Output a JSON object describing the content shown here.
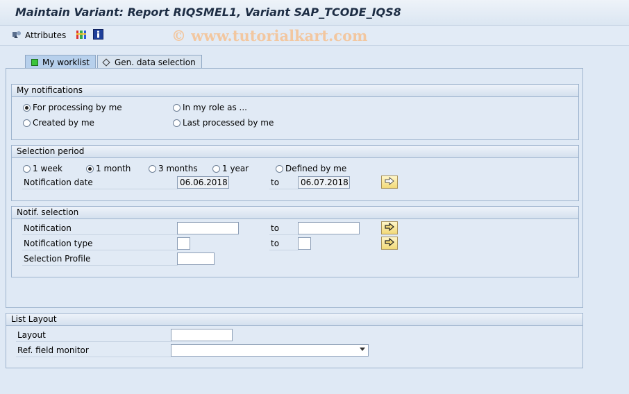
{
  "window": {
    "title": "Maintain Variant: Report RIQSMEL1, Variant SAP_TCODE_IQS8"
  },
  "toolbar": {
    "attributes_label": "Attributes",
    "watermark": "© www.tutorialkart.com"
  },
  "tabs": [
    {
      "label": "My worklist",
      "active": true
    },
    {
      "label": "Gen. data selection",
      "active": false
    }
  ],
  "my_notifications": {
    "title": "My notifications",
    "options": [
      {
        "label": "For processing by me",
        "selected": true
      },
      {
        "label": "In my role as ...",
        "selected": false
      },
      {
        "label": "Created by me",
        "selected": false
      },
      {
        "label": "Last processed by me",
        "selected": false
      }
    ]
  },
  "selection_period": {
    "title": "Selection period",
    "options": [
      {
        "label": "1 week",
        "selected": false
      },
      {
        "label": "1 month",
        "selected": true
      },
      {
        "label": "3 months",
        "selected": false
      },
      {
        "label": "1 year",
        "selected": false
      },
      {
        "label": "Defined by me",
        "selected": false
      }
    ],
    "date_label": "Notification date",
    "from": "06.06.2018",
    "to_label": "to",
    "to": "06.07.2018"
  },
  "notif_selection": {
    "title": "Notif. selection",
    "rows": [
      {
        "label": "Notification",
        "from": "",
        "to_label": "to",
        "to": ""
      },
      {
        "label": "Notification type",
        "from": "",
        "to_label": "to",
        "to": ""
      },
      {
        "label": "Selection Profile",
        "from": ""
      }
    ]
  },
  "list_layout": {
    "title": "List Layout",
    "layout_label": "Layout",
    "layout_value": "",
    "ref_label": "Ref. field monitor",
    "ref_value": ""
  },
  "colors": {
    "accent": "#b7d0ec",
    "background": "#dfe9f5",
    "button": "#f2d978"
  }
}
